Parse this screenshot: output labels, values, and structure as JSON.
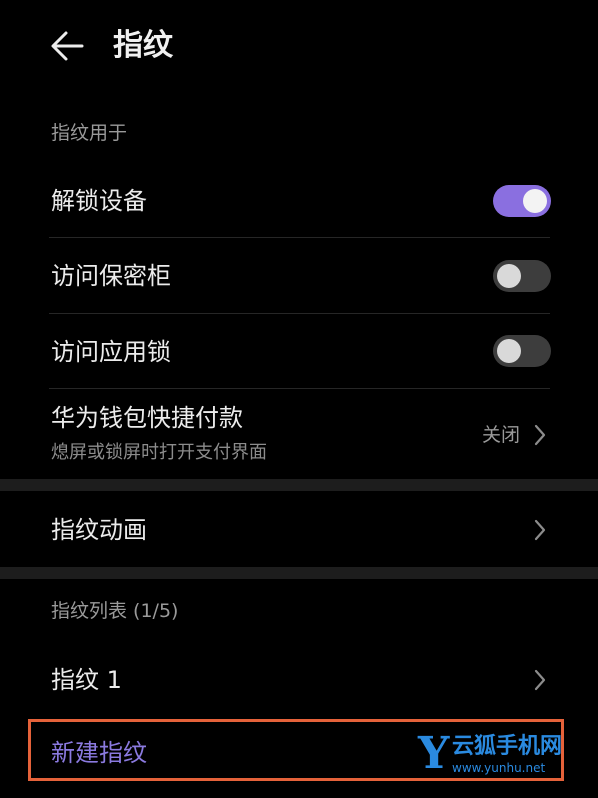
{
  "header": {
    "title": "指纹",
    "back_icon": "arrow-left-icon"
  },
  "usage_section": {
    "label": "指纹用于",
    "items": [
      {
        "label": "解锁设备",
        "toggle_on": true
      },
      {
        "label": "访问保密柜",
        "toggle_on": false
      },
      {
        "label": "访问应用锁",
        "toggle_on": false
      }
    ],
    "wallet": {
      "title": "华为钱包快捷付款",
      "subtitle": "熄屏或锁屏时打开支付界面",
      "value": "关闭"
    }
  },
  "animation": {
    "label": "指纹动画"
  },
  "list_section": {
    "label": "指纹列表 (1/5)",
    "items": [
      {
        "label": "指纹 1"
      }
    ],
    "new_label": "新建指纹"
  },
  "watermark": {
    "letter": "Y",
    "name": "云狐手机网",
    "url": "www.yunhu.net"
  },
  "colors": {
    "background": "#000000",
    "accent": "#8a6fe0",
    "highlight_border": "#e5623a",
    "watermark": "#2a8ae0"
  }
}
